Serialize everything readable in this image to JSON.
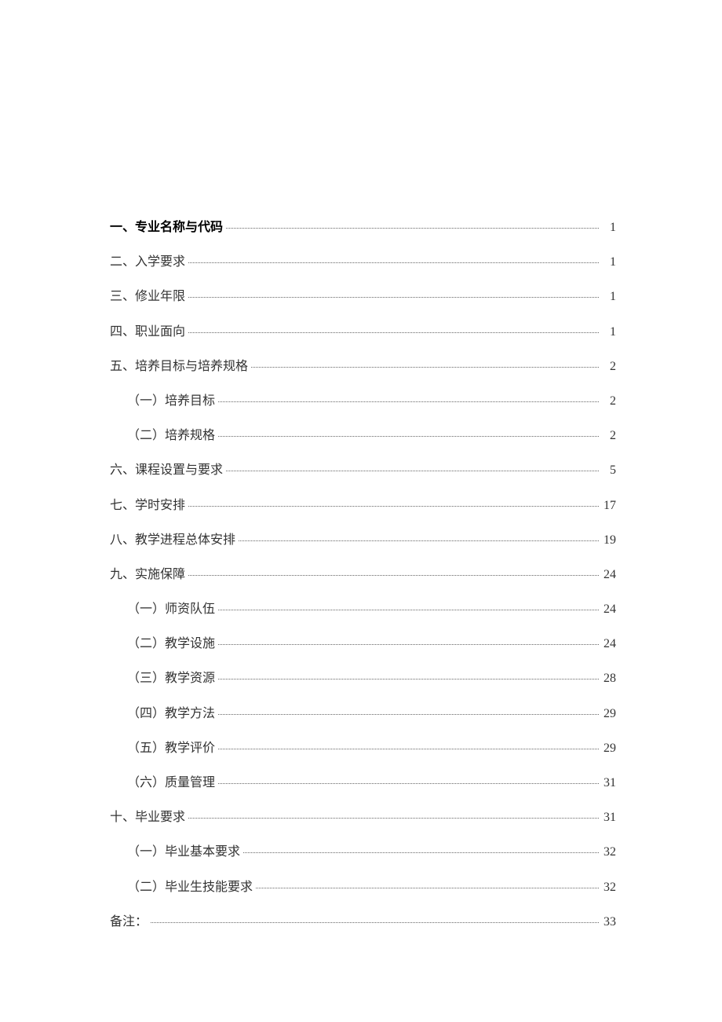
{
  "toc": [
    {
      "level": 1,
      "bold": true,
      "title": "一、专业名称与代码",
      "page": "1",
      "trailing_space": true
    },
    {
      "level": 1,
      "bold": false,
      "title": "二、入学要求",
      "page": "1",
      "trailing_space": false
    },
    {
      "level": 1,
      "bold": false,
      "title": "三、修业年限",
      "page": "1",
      "trailing_space": false
    },
    {
      "level": 1,
      "bold": false,
      "title": "四、职业面向",
      "page": "1",
      "trailing_space": false
    },
    {
      "level": 1,
      "bold": false,
      "title": "五、培养目标与培养规格",
      "page": "2",
      "trailing_space": false
    },
    {
      "level": 2,
      "bold": false,
      "title": "（一）培养目标",
      "page": "2",
      "trailing_space": false
    },
    {
      "level": 2,
      "bold": false,
      "title": "（二）培养规格",
      "page": "2",
      "trailing_space": false
    },
    {
      "level": 1,
      "bold": false,
      "title": "六、课程设置与要求",
      "page": "5",
      "trailing_space": false
    },
    {
      "level": 1,
      "bold": false,
      "title": "七、学时安排",
      "page": "17",
      "trailing_space": true
    },
    {
      "level": 1,
      "bold": false,
      "title": "八、教学进程总体安排",
      "page": "19",
      "trailing_space": true
    },
    {
      "level": 1,
      "bold": false,
      "title": "九、实施保障",
      "page": "24",
      "trailing_space": true
    },
    {
      "level": 2,
      "bold": false,
      "title": "（一）师资队伍",
      "page": "24",
      "trailing_space": true
    },
    {
      "level": 2,
      "bold": false,
      "title": "（二）教学设施",
      "page": "24",
      "trailing_space": true
    },
    {
      "level": 2,
      "bold": false,
      "title": "（三）教学资源",
      "page": "28",
      "trailing_space": true
    },
    {
      "level": 2,
      "bold": false,
      "title": "（四）教学方法",
      "page": "29",
      "trailing_space": true
    },
    {
      "level": 2,
      "bold": false,
      "title": "（五）教学评价",
      "page": "29",
      "trailing_space": true
    },
    {
      "level": 2,
      "bold": false,
      "title": "（六）质量管理",
      "page": "31",
      "trailing_space": true
    },
    {
      "level": 1,
      "bold": false,
      "title": "十、毕业要求",
      "page": "31",
      "trailing_space": true
    },
    {
      "level": 2,
      "bold": false,
      "title": "（一）毕业基本要求",
      "page": "32",
      "trailing_space": true
    },
    {
      "level": 2,
      "bold": false,
      "title": "（二）毕业生技能要求",
      "page": "32",
      "trailing_space": true
    },
    {
      "level": 1,
      "bold": false,
      "title": "备注：",
      "page": "33",
      "trailing_space": true
    }
  ]
}
